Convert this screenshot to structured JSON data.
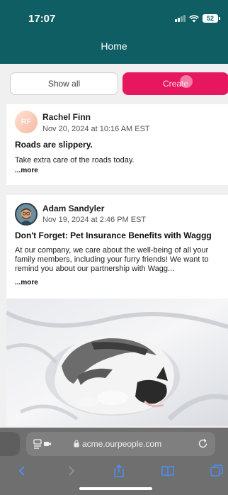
{
  "status_bar": {
    "time": "17:07",
    "battery": "52"
  },
  "header": {
    "title": "Home"
  },
  "tabs": {
    "show_all": "Show all",
    "create": "Create"
  },
  "posts": [
    {
      "avatar_initials": "RF",
      "author": "Rachel Finn",
      "timestamp": "Nov 20, 2024 at 10:16 AM EST",
      "title": "Roads are slippery.",
      "body": "Take extra care of the roads today.",
      "more": "...more"
    },
    {
      "author": "Adam Sandyler",
      "timestamp": "Nov 19, 2024 at 2:46 PM EST",
      "title": "Don't Forget: Pet Insurance Benefits with Waggg",
      "body": "At our company, we care about the well-being of all your family members, including your furry friends! We want to remind you about our partnership with Wagg...",
      "more": "...more"
    }
  ],
  "browser": {
    "url": "acme.ourpeople.com"
  },
  "icons": {
    "signal": "signal-icon",
    "wifi": "wifi-icon",
    "battery": "battery-icon",
    "page_menu": "page-menu-icon",
    "lock": "lock-icon",
    "reload": "reload-icon",
    "back": "back-icon",
    "forward": "forward-icon",
    "share": "share-icon",
    "bookmarks": "bookmarks-icon",
    "tabs": "tabs-icon"
  },
  "colors": {
    "header": "#0f5e63",
    "create_button": "#e6175f",
    "safari_link": "#4a8ff7"
  }
}
